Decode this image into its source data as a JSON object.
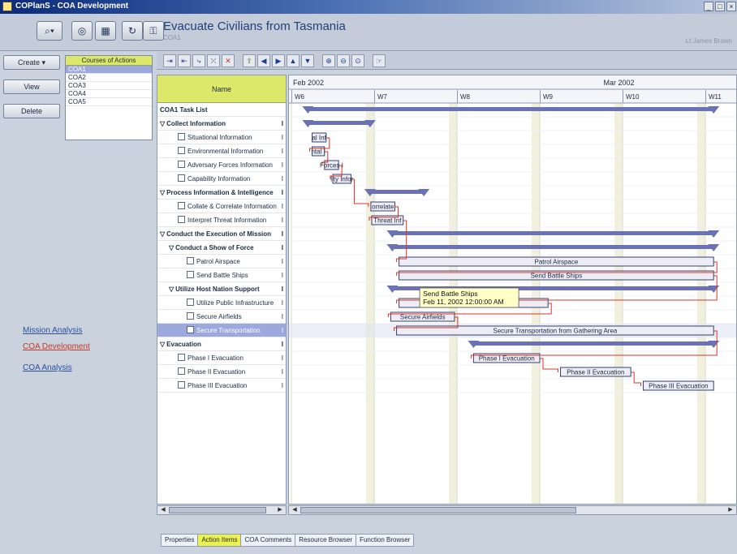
{
  "window": {
    "title": "COPlanS - COA Development"
  },
  "header": {
    "title": "Evacuate Civilians from Tasmania",
    "subtitle": "COA1",
    "user": "Lt James Brown"
  },
  "side": {
    "create_label": "Create",
    "view_label": "View",
    "delete_label": "Delete",
    "coa_header": "Courses of Actions",
    "coa_items": [
      "COA1",
      "COA2",
      "COA3",
      "COA4",
      "COA5"
    ],
    "links": [
      "Mission Analysis",
      "COA Development",
      "COA Analysis"
    ],
    "link_colors": [
      "#2e4f9c",
      "#c0392b",
      "#2e4f9c"
    ]
  },
  "table": {
    "header": "Name",
    "rows": [
      {
        "name": "COA1 Task List",
        "col2": "",
        "level": 0,
        "bold": true,
        "arrow": "",
        "icon": false,
        "sel": false
      },
      {
        "name": "Collect Information",
        "col2": "I",
        "level": 0,
        "bold": true,
        "arrow": "▽",
        "icon": false,
        "sel": false
      },
      {
        "name": "Situational Information",
        "col2": "I",
        "level": 2,
        "bold": false,
        "arrow": "",
        "icon": true,
        "sel": false
      },
      {
        "name": "Environmental Information",
        "col2": "I",
        "level": 2,
        "bold": false,
        "arrow": "",
        "icon": true,
        "sel": false
      },
      {
        "name": "Adversary Forces Information",
        "col2": "I",
        "level": 2,
        "bold": false,
        "arrow": "",
        "icon": true,
        "sel": false
      },
      {
        "name": "Capability Information",
        "col2": "I",
        "level": 2,
        "bold": false,
        "arrow": "",
        "icon": true,
        "sel": false
      },
      {
        "name": "Process Information & Intelligence",
        "col2": "I",
        "level": 0,
        "bold": true,
        "arrow": "▽",
        "icon": false,
        "sel": false
      },
      {
        "name": "Collate & Correlate Information",
        "col2": "I",
        "level": 2,
        "bold": false,
        "arrow": "",
        "icon": true,
        "sel": false
      },
      {
        "name": "Interpret Threat Information",
        "col2": "I",
        "level": 2,
        "bold": false,
        "arrow": "",
        "icon": true,
        "sel": false
      },
      {
        "name": "Conduct the Execution of Mission",
        "col2": "I",
        "level": 0,
        "bold": true,
        "arrow": "▽",
        "icon": false,
        "sel": false
      },
      {
        "name": "Conduct a Show of Force",
        "col2": "I",
        "level": 1,
        "bold": true,
        "arrow": "▽",
        "icon": false,
        "sel": false
      },
      {
        "name": "Patrol Airspace",
        "col2": "I",
        "level": 3,
        "bold": false,
        "arrow": "",
        "icon": true,
        "sel": false
      },
      {
        "name": "Send Battle Ships",
        "col2": "I",
        "level": 3,
        "bold": false,
        "arrow": "",
        "icon": true,
        "sel": false
      },
      {
        "name": "Utilize Host Nation Support",
        "col2": "I",
        "level": 1,
        "bold": true,
        "arrow": "▽",
        "icon": false,
        "sel": false
      },
      {
        "name": "Utilize Public Infrastructure",
        "col2": "I",
        "level": 3,
        "bold": false,
        "arrow": "",
        "icon": true,
        "sel": false
      },
      {
        "name": "Secure Airfields",
        "col2": "I",
        "level": 3,
        "bold": false,
        "arrow": "",
        "icon": true,
        "sel": false
      },
      {
        "name": "Secure Transportation",
        "col2": "I",
        "level": 3,
        "bold": false,
        "arrow": "",
        "icon": true,
        "sel": true
      },
      {
        "name": "Evacuation",
        "col2": "I",
        "level": 0,
        "bold": true,
        "arrow": "▽",
        "icon": false,
        "sel": false
      },
      {
        "name": "Phase I Evacuation",
        "col2": "I",
        "level": 2,
        "bold": false,
        "arrow": "",
        "icon": true,
        "sel": false
      },
      {
        "name": "Phase II Evacuation",
        "col2": "I",
        "level": 2,
        "bold": false,
        "arrow": "",
        "icon": true,
        "sel": false
      },
      {
        "name": "Phase III Evacuation",
        "col2": "I",
        "level": 2,
        "bold": false,
        "arrow": "",
        "icon": true,
        "sel": false
      }
    ]
  },
  "gantt": {
    "months": [
      {
        "label": "Feb 2002",
        "col": 0
      },
      {
        "label": "Mar 2002",
        "col": 3.75
      }
    ],
    "weeks": [
      "W6",
      "W7",
      "W8",
      "W9",
      "W10",
      "W11"
    ],
    "bars": [
      {
        "row": 0,
        "start": 0.2,
        "end": 5.1,
        "kind": "summary",
        "label": ""
      },
      {
        "row": 1,
        "start": 0.2,
        "end": 0.95,
        "kind": "summary",
        "label": ""
      },
      {
        "row": 2,
        "start": 0.25,
        "end": 0.42,
        "kind": "task",
        "label": "al Inf"
      },
      {
        "row": 3,
        "start": 0.25,
        "end": 0.4,
        "kind": "task",
        "label": "ntal I"
      },
      {
        "row": 4,
        "start": 0.4,
        "end": 0.57,
        "kind": "task",
        "label": "Forces I"
      },
      {
        "row": 5,
        "start": 0.5,
        "end": 0.72,
        "kind": "task",
        "label": "lity Infor"
      },
      {
        "row": 6,
        "start": 0.95,
        "end": 1.6,
        "kind": "summary",
        "label": ""
      },
      {
        "row": 7,
        "start": 0.96,
        "end": 1.25,
        "kind": "task",
        "label": "orrelate"
      },
      {
        "row": 8,
        "start": 0.97,
        "end": 1.35,
        "kind": "task",
        "label": "Threat Inf"
      },
      {
        "row": 9,
        "start": 1.22,
        "end": 5.1,
        "kind": "summary",
        "label": ""
      },
      {
        "row": 10,
        "start": 1.22,
        "end": 5.1,
        "kind": "summary",
        "label": ""
      },
      {
        "row": 11,
        "start": 1.3,
        "end": 5.1,
        "kind": "task",
        "label": "Patrol Airspace"
      },
      {
        "row": 12,
        "start": 1.3,
        "end": 5.1,
        "kind": "task",
        "label": "Send Battle Ships"
      },
      {
        "row": 13,
        "start": 1.22,
        "end": 5.1,
        "kind": "summary",
        "label": ""
      },
      {
        "row": 14,
        "start": 1.3,
        "end": 3.1,
        "kind": "task",
        "label": "Utilize Public Infrastructure"
      },
      {
        "row": 15,
        "start": 1.2,
        "end": 1.97,
        "kind": "task",
        "label": "Secure Airfields"
      },
      {
        "row": 16,
        "start": 1.27,
        "end": 5.1,
        "kind": "task",
        "label": "Secure Transportation from Gathering Area"
      },
      {
        "row": 17,
        "start": 2.2,
        "end": 5.1,
        "kind": "summary",
        "label": ""
      },
      {
        "row": 18,
        "start": 2.2,
        "end": 3.0,
        "kind": "task",
        "label": "Phase I Evacuation"
      },
      {
        "row": 19,
        "start": 3.25,
        "end": 4.1,
        "kind": "task",
        "label": "Phase II Evacuation"
      },
      {
        "row": 20,
        "start": 4.25,
        "end": 5.1,
        "kind": "task",
        "label": "Phase III Evacuation"
      }
    ],
    "tooltip": {
      "title": "Send Battle Ships",
      "time": "Feb 11, 2002 12:00:00 AM",
      "row": 14,
      "col": 1.55
    },
    "colors": {
      "bar_fill": "#ecedf5",
      "bar_border": "#3a3f6b",
      "summary": "#6b71b5",
      "link": "#d9352c",
      "weekend": "#f1f0dd",
      "tooltip": "#ffffc8"
    }
  },
  "tabs": [
    {
      "label": "Properties",
      "active": false
    },
    {
      "label": "Action Items",
      "active": true
    },
    {
      "label": "COA Comments",
      "active": false
    },
    {
      "label": "Resource Browser",
      "active": false
    },
    {
      "label": "Function Browser",
      "active": false
    }
  ]
}
